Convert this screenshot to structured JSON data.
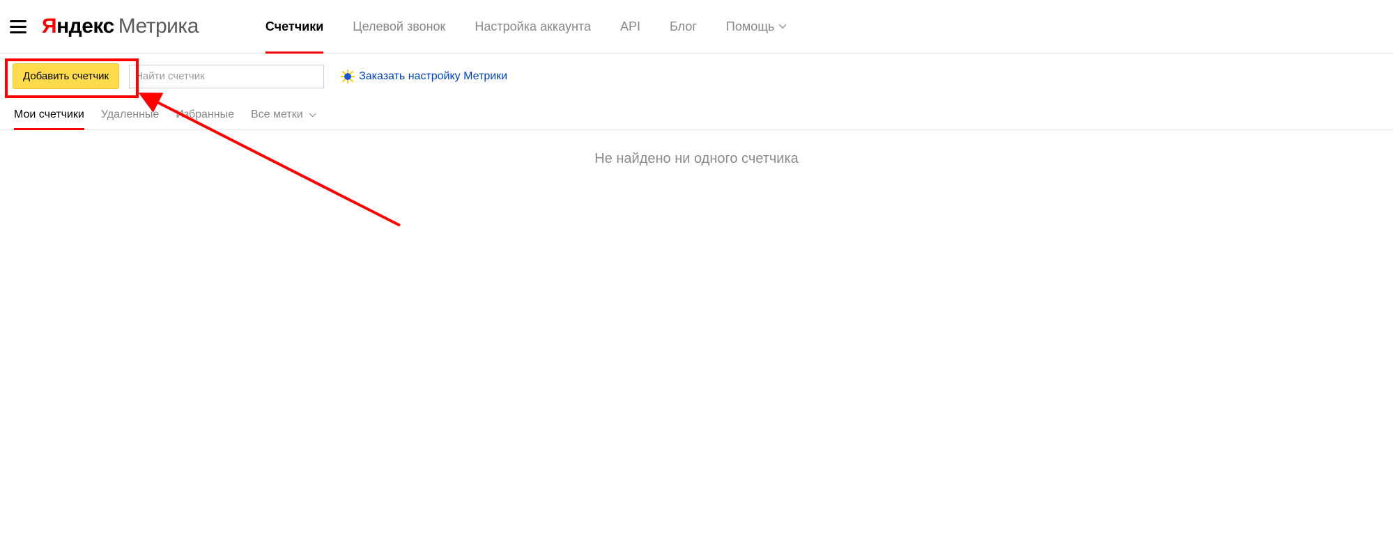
{
  "header": {
    "logo": {
      "ya_y": "Я",
      "ya_ndex": "ндекс",
      "metrika": "Метрика"
    },
    "nav": [
      {
        "label": "Счетчики",
        "active": true
      },
      {
        "label": "Целевой звонок"
      },
      {
        "label": "Настройка аккаунта"
      },
      {
        "label": "API"
      },
      {
        "label": "Блог"
      },
      {
        "label": "Помощь",
        "dropdown": true
      }
    ]
  },
  "toolbar": {
    "add_label": "Добавить счетчик",
    "search_placeholder": "Найти счетчик",
    "promo_label": "Заказать настройку Метрики"
  },
  "tabs": [
    {
      "label": "Мои счетчики",
      "active": true
    },
    {
      "label": "Удаленные"
    },
    {
      "label": "Избранные"
    },
    {
      "label": "Все метки",
      "dropdown": true
    }
  ],
  "main": {
    "empty_text": "Не найдено ни одного счетчика"
  }
}
